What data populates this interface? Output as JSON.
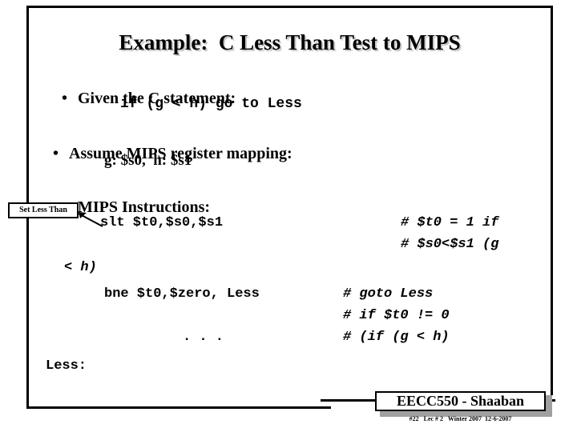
{
  "slide": {
    "title": "Example:  C Less Than Test to MIPS",
    "background_color": "#ffffff",
    "text_color": "#000000",
    "shadow_color": "#c8c8c8"
  },
  "bullets": [
    {
      "marker": "•",
      "text": "Given the C statement:"
    },
    {
      "marker": "•",
      "text": "Assume MIPS register mapping:"
    },
    {
      "marker": "•",
      "text": "MIPS Instructions:"
    }
  ],
  "sublines": [
    {
      "text": "if (g < h) go to Less",
      "mono": true
    },
    {
      "text": "g: $s0,  h: $s1",
      "mono": false
    }
  ],
  "callout": {
    "label": "Set Less Than"
  },
  "code": {
    "lines": [
      {
        "text": "slt $t0,$s0,$s1"
      },
      {
        "text": "< h)"
      },
      {
        "text": "bne $t0,$zero, Less"
      },
      {
        "text": ". . ."
      },
      {
        "text": "Less:"
      }
    ],
    "comments": [
      {
        "text": "# $t0 = 1 if"
      },
      {
        "text": "# $s0<$s1 (g"
      },
      {
        "text": "# goto Less"
      },
      {
        "text": "# if $t0 != 0"
      },
      {
        "text": "# (if (g < h)"
      }
    ]
  },
  "footer": {
    "course": "EECC550 - Shaaban",
    "meta": "#22   Lec # 2   Winter 2007  12-6-2007"
  }
}
